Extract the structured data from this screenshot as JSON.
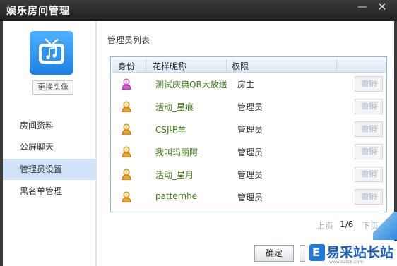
{
  "window": {
    "title": "娱乐房间管理",
    "minimize_label": "—",
    "close_label": "✕"
  },
  "sidebar": {
    "change_avatar_label": "更换头像",
    "items": [
      {
        "label": "房间资料",
        "active": false
      },
      {
        "label": "公屏聊天",
        "active": false
      },
      {
        "label": "管理员设置",
        "active": true
      },
      {
        "label": "黑名单管理",
        "active": false
      }
    ]
  },
  "main": {
    "section_title": "管理员列表",
    "table": {
      "headers": [
        "身份",
        "花样昵称",
        "权限"
      ],
      "rows": [
        {
          "role_icon": "owner-person-icon",
          "nickname": "测试庆典QB大放送",
          "permission": "房主",
          "action": "撤销"
        },
        {
          "role_icon": "admin-person-icon",
          "nickname": "活动_星痕",
          "permission": "管理员",
          "action": "撤销"
        },
        {
          "role_icon": "admin-person-icon",
          "nickname": "CSJ肥羊",
          "permission": "管理员",
          "action": "撤销"
        },
        {
          "role_icon": "admin-person-icon",
          "nickname": "我叫玛丽阿_",
          "permission": "管理员",
          "action": "撤销"
        },
        {
          "role_icon": "admin-person-icon",
          "nickname": "活动_星月",
          "permission": "管理员",
          "action": "撤销"
        },
        {
          "role_icon": "admin-person-icon",
          "nickname": "patternhe",
          "permission": "管理员",
          "action": "撤销"
        }
      ]
    },
    "pager": {
      "prev_label": "上页",
      "page": "1/6",
      "next_label": "下页"
    }
  },
  "footer": {
    "ok_label": "确定"
  },
  "watermark": {
    "text": "易采站长站",
    "sub": "www.easck.com"
  },
  "colors": {
    "owner_icon": "#d24fc4",
    "admin_icon": "#f0a020",
    "nickname": "#3f7a10",
    "nav_active": "#cfe2f7",
    "table_border": "#8fb8e3"
  }
}
